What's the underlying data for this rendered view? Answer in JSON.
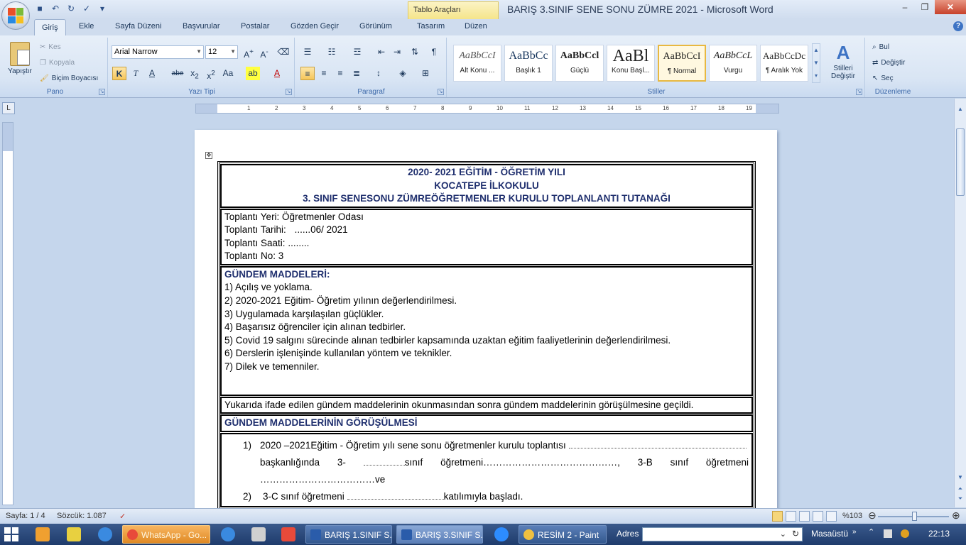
{
  "window": {
    "title": "BARIŞ 3.SINIF SENE SONU ZÜMRE 2021 - Microsoft Word",
    "context_tab": "Tablo Araçları"
  },
  "tabs": [
    "Giriş",
    "Ekle",
    "Sayfa Düzeni",
    "Başvurular",
    "Postalar",
    "Gözden Geçir",
    "Görünüm",
    "Tasarım",
    "Düzen"
  ],
  "ribbon": {
    "pano": {
      "label": "Pano",
      "paste": "Yapıştır",
      "cut": "Kes",
      "copy": "Kopyala",
      "format_painter": "Biçim Boyacısı"
    },
    "font": {
      "label": "Yazı Tipi",
      "font_name": "Arial Narrow",
      "font_size": "12"
    },
    "paragraph": {
      "label": "Paragraf"
    },
    "styles": {
      "label": "Stiller",
      "items": [
        {
          "sample": "AaBbCcI",
          "name": "Alt Konu ..."
        },
        {
          "sample": "AaBbCc",
          "name": "Başlık 1"
        },
        {
          "sample": "AaBbCcl",
          "name": "Güçlü"
        },
        {
          "sample": "AaBl",
          "name": "Konu Başl..."
        },
        {
          "sample": "AaBbCcI",
          "name": "¶ Normal"
        },
        {
          "sample": "AaBbCcL",
          "name": "Vurgu"
        },
        {
          "sample": "AaBbCcDc",
          "name": "¶ Aralık Yok"
        }
      ],
      "change_styles": "Stilleri Değiştir"
    },
    "editing": {
      "label": "Düzenleme",
      "find": "Bul",
      "replace": "Değiştir",
      "select": "Seç"
    }
  },
  "document": {
    "header": [
      "2020- 2021 EĞİTİM - ÖĞRETİM YILI",
      "KOCATEPE  İLKOKULU",
      "3. SINIF SENESONU ZÜMREÖĞRETMENLER KURULU TOPLANLANTI TUTANAĞI"
    ],
    "meeting": {
      "place": "Toplantı Yeri: Öğretmenler Odası",
      "date_label": "Toplantı Tarihi:",
      "date_dots": "......",
      "date_value": "06/ 2021",
      "time_label": "Toplantı Saati:",
      "time_dots": "........",
      "number": "Toplantı No: 3"
    },
    "agenda_title": "GÜNDEM MADDELERİ:",
    "agenda": [
      "1) Açılış ve yoklama.",
      "2) 2020-2021 Eğitim- Öğretim yılının değerlendirilmesi.",
      "3) Uygulamada karşılaşılan güçlükler.",
      "4) Başarısız öğrenciler için alınan tedbirler.",
      "5) Covid 19 salgını sürecinde alınan tedbirler kapsamında uzaktan eğitim faaliyetlerinin değerlendirilmesi.",
      "6) Derslerin işlenişinde kullanılan yöntem ve teknikler.",
      "7) Dilek ve temenniler."
    ],
    "transition": "Yukarıda ifade edilen gündem maddelerinin okunmasından sonra gündem maddelerinin görüşülmesine geçildi.",
    "discussion_title": "GÜNDEM MADDELERİNİN GÖRÜŞÜLMESİ",
    "items": [
      {
        "num": "1)",
        "line1": "2020 –2021Eğitim - Öğretim yılı sene sonu öğretmenler kurulu toplantısı",
        "line2a": "başkanlığında",
        "line2b": "3-",
        "line2c": "sınıf",
        "line2d": "öğretmeni",
        "line2e": "3-B",
        "line2f": "sınıf",
        "line2g": "öğretmeni",
        "line3": "ve"
      },
      {
        "num": "2)",
        "text_a": "3-C sınıf öğretmeni",
        "text_b": "katılımıyla başladı."
      }
    ]
  },
  "statusbar": {
    "page": "Sayfa: 1 / 4",
    "words": "Sözcük: 1.087",
    "zoom": "%103"
  },
  "taskbar": {
    "buttons": [
      "WhatsApp - Go...",
      "BARIŞ 1.SINIF S...",
      "BARIŞ 3.SINIF S...",
      "RESİM 2 - Paint"
    ],
    "address_label": "Adres",
    "desktop": "Masaüstü",
    "clock": "22:13"
  },
  "colors": {
    "heading_blue": "#1f2f6e",
    "ribbon_bg": "#dbe6f4",
    "taskbar": "#2a4a7c",
    "active_style": "#e8b840"
  }
}
